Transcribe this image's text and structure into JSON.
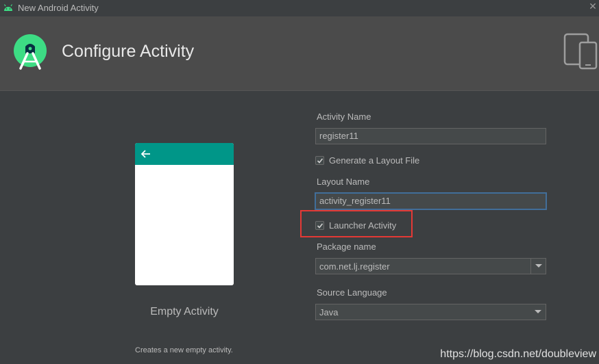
{
  "window": {
    "title": "New Android Activity"
  },
  "header": {
    "title": "Configure Activity"
  },
  "template": {
    "name": "Empty Activity",
    "description": "Creates a new empty activity."
  },
  "form": {
    "activity_name_label": "Activity Name",
    "activity_name_value": "register11",
    "generate_layout_label": "Generate a Layout File",
    "generate_layout_checked": true,
    "layout_name_label": "Layout Name",
    "layout_name_value": "activity_register11",
    "launcher_activity_label": "Launcher Activity",
    "launcher_activity_checked": true,
    "package_name_label": "Package name",
    "package_name_value": "com.net.lj.register",
    "source_language_label": "Source Language",
    "source_language_value": "Java"
  },
  "watermark": "https://blog.csdn.net/doubleview",
  "colors": {
    "background": "#3c3f41",
    "header": "#4b4b4b",
    "appbar": "#009688",
    "highlight": "#e53935",
    "android_green": "#3ddc84"
  },
  "icons": [
    "android-icon",
    "close-icon",
    "android-studio-logo-icon",
    "devices-icon",
    "back-arrow-icon",
    "check-icon",
    "dropdown-arrow-icon"
  ]
}
